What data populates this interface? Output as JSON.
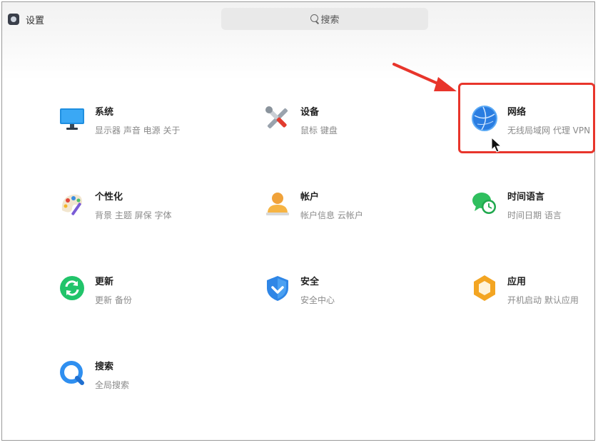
{
  "window": {
    "title": "设置",
    "search_placeholder": "搜索"
  },
  "tiles": [
    {
      "name": "系统",
      "desc": "显示器 声音 电源 关于",
      "icon": "monitor-icon"
    },
    {
      "name": "设备",
      "desc": "鼠标 键盘",
      "icon": "tools-icon"
    },
    {
      "name": "网络",
      "desc": "无线局域网 代理 VPN",
      "icon": "globe-icon"
    },
    {
      "name": "个性化",
      "desc": "背景 主题 屏保 字体",
      "icon": "palette-icon"
    },
    {
      "name": "帐户",
      "desc": "帐户信息 云帐户",
      "icon": "user-icon"
    },
    {
      "name": "时间语言",
      "desc": "时间日期 语言",
      "icon": "time-language-icon"
    },
    {
      "name": "更新",
      "desc": "更新 备份",
      "icon": "update-icon"
    },
    {
      "name": "安全",
      "desc": "安全中心",
      "icon": "shield-icon"
    },
    {
      "name": "应用",
      "desc": "开机启动 默认应用",
      "icon": "apps-icon"
    },
    {
      "name": "搜索",
      "desc": "全局搜索",
      "icon": "search-icon"
    }
  ],
  "annotation": {
    "color": "#e8352b",
    "highlighted_tile": "网络"
  }
}
